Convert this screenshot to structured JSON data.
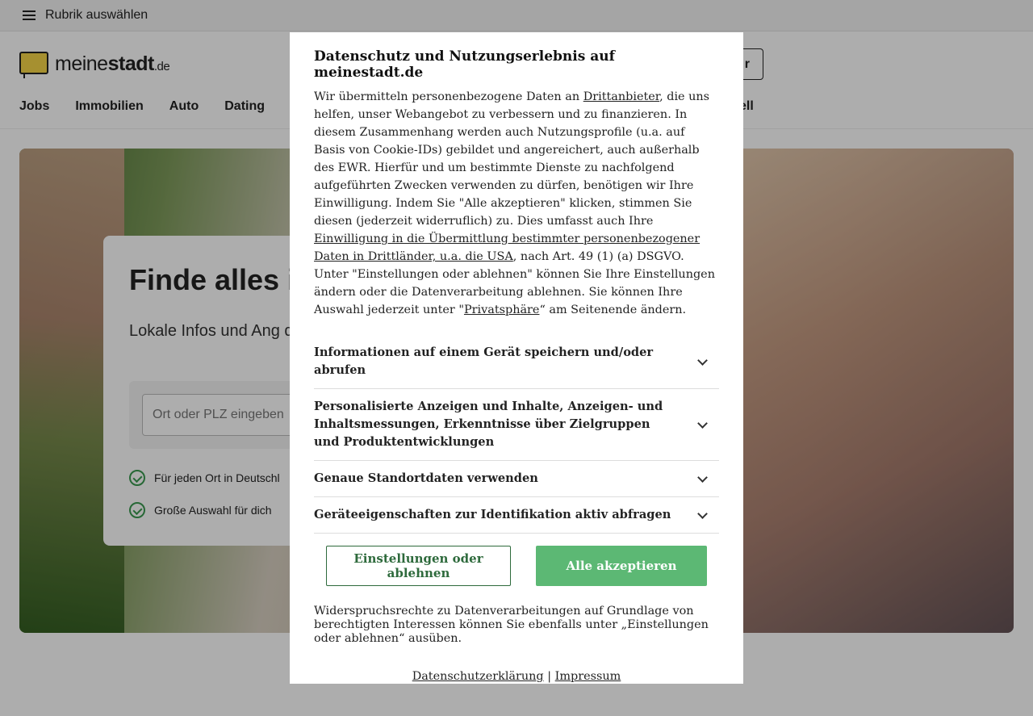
{
  "topbar": {
    "menu_label": "Rubrik auswählen"
  },
  "header": {
    "logo": {
      "text_light": "meine",
      "text_bold": "stadt",
      "tld": ".de"
    },
    "button_partial": "r",
    "nav": [
      "Jobs",
      "Immobilien",
      "Auto",
      "Dating"
    ],
    "nav_extra_partial": "ell"
  },
  "hero": {
    "title_partial": "Finde alles i",
    "subtitle_partial": "Lokale Infos und Ang deinen Ort.",
    "search_placeholder": "Ort oder PLZ eingeben",
    "features": [
      "Für jeden Ort in Deutschl",
      "Große Auswahl für dich"
    ]
  },
  "consent": {
    "title": "Datenschutz und Nutzungserlebnis auf meinestadt.de",
    "body": {
      "p1": "Wir übermitteln personenbezogene Daten an ",
      "link_drittanbieter": "Drittanbieter",
      "p2": ", die uns helfen, unser Webangebot zu verbessern und zu finanzieren. In diesem Zusammenhang werden auch Nutzungsprofile (u.a. auf Basis von Cookie-IDs) gebildet und angereichert, auch außerhalb des EWR. Hierfür und um bestimmte Dienste zu nachfolgend aufgeführten Zwecken verwenden zu dürfen, benötigen wir Ihre Einwilligung. Indem Sie \"Alle akzeptieren\" klicken, stimmen Sie diesen (jederzeit widerruflich) zu. Dies umfasst auch Ihre ",
      "link_drittlaender": "Einwilligung in die Übermittlung bestimmter personenbezogener Daten in Drittländer, u.a. die USA",
      "p3": ", nach Art. 49 (1) (a) DSGVO. Unter \"Einstellungen oder ablehnen\" können Sie Ihre Einstellungen ändern oder die Datenverarbeitung ablehnen. Sie können Ihre Auswahl jederzeit unter \"",
      "link_privatsphaere": "Privatsphäre",
      "p4": "“ am Seitenende ändern."
    },
    "purposes": [
      "Informationen auf einem Gerät speichern und/oder abrufen",
      "Personalisierte Anzeigen und Inhalte, Anzeigen- und Inhaltsmessungen, Erkenntnisse über Zielgruppen und Produktentwicklungen",
      "Genaue Standortdaten verwenden",
      "Geräteeigenschaften zur Identifikation aktiv abfragen"
    ],
    "btn_settings": "Einstellungen oder ablehnen",
    "btn_accept": "Alle akzeptieren",
    "note": "Widerspruchsrechte zu Datenverarbeitungen auf Grundlage von berechtigten Interessen können Sie ebenfalls unter „Einstellungen oder ablehnen“ ausüben.",
    "link_privacy": "Datenschutzerklärung",
    "link_separator": "|",
    "link_imprint": "Impressum"
  },
  "colors": {
    "accept_green": "#5cb874",
    "settings_green": "#2e6a3c",
    "logo_yellow": "#f5d547"
  }
}
